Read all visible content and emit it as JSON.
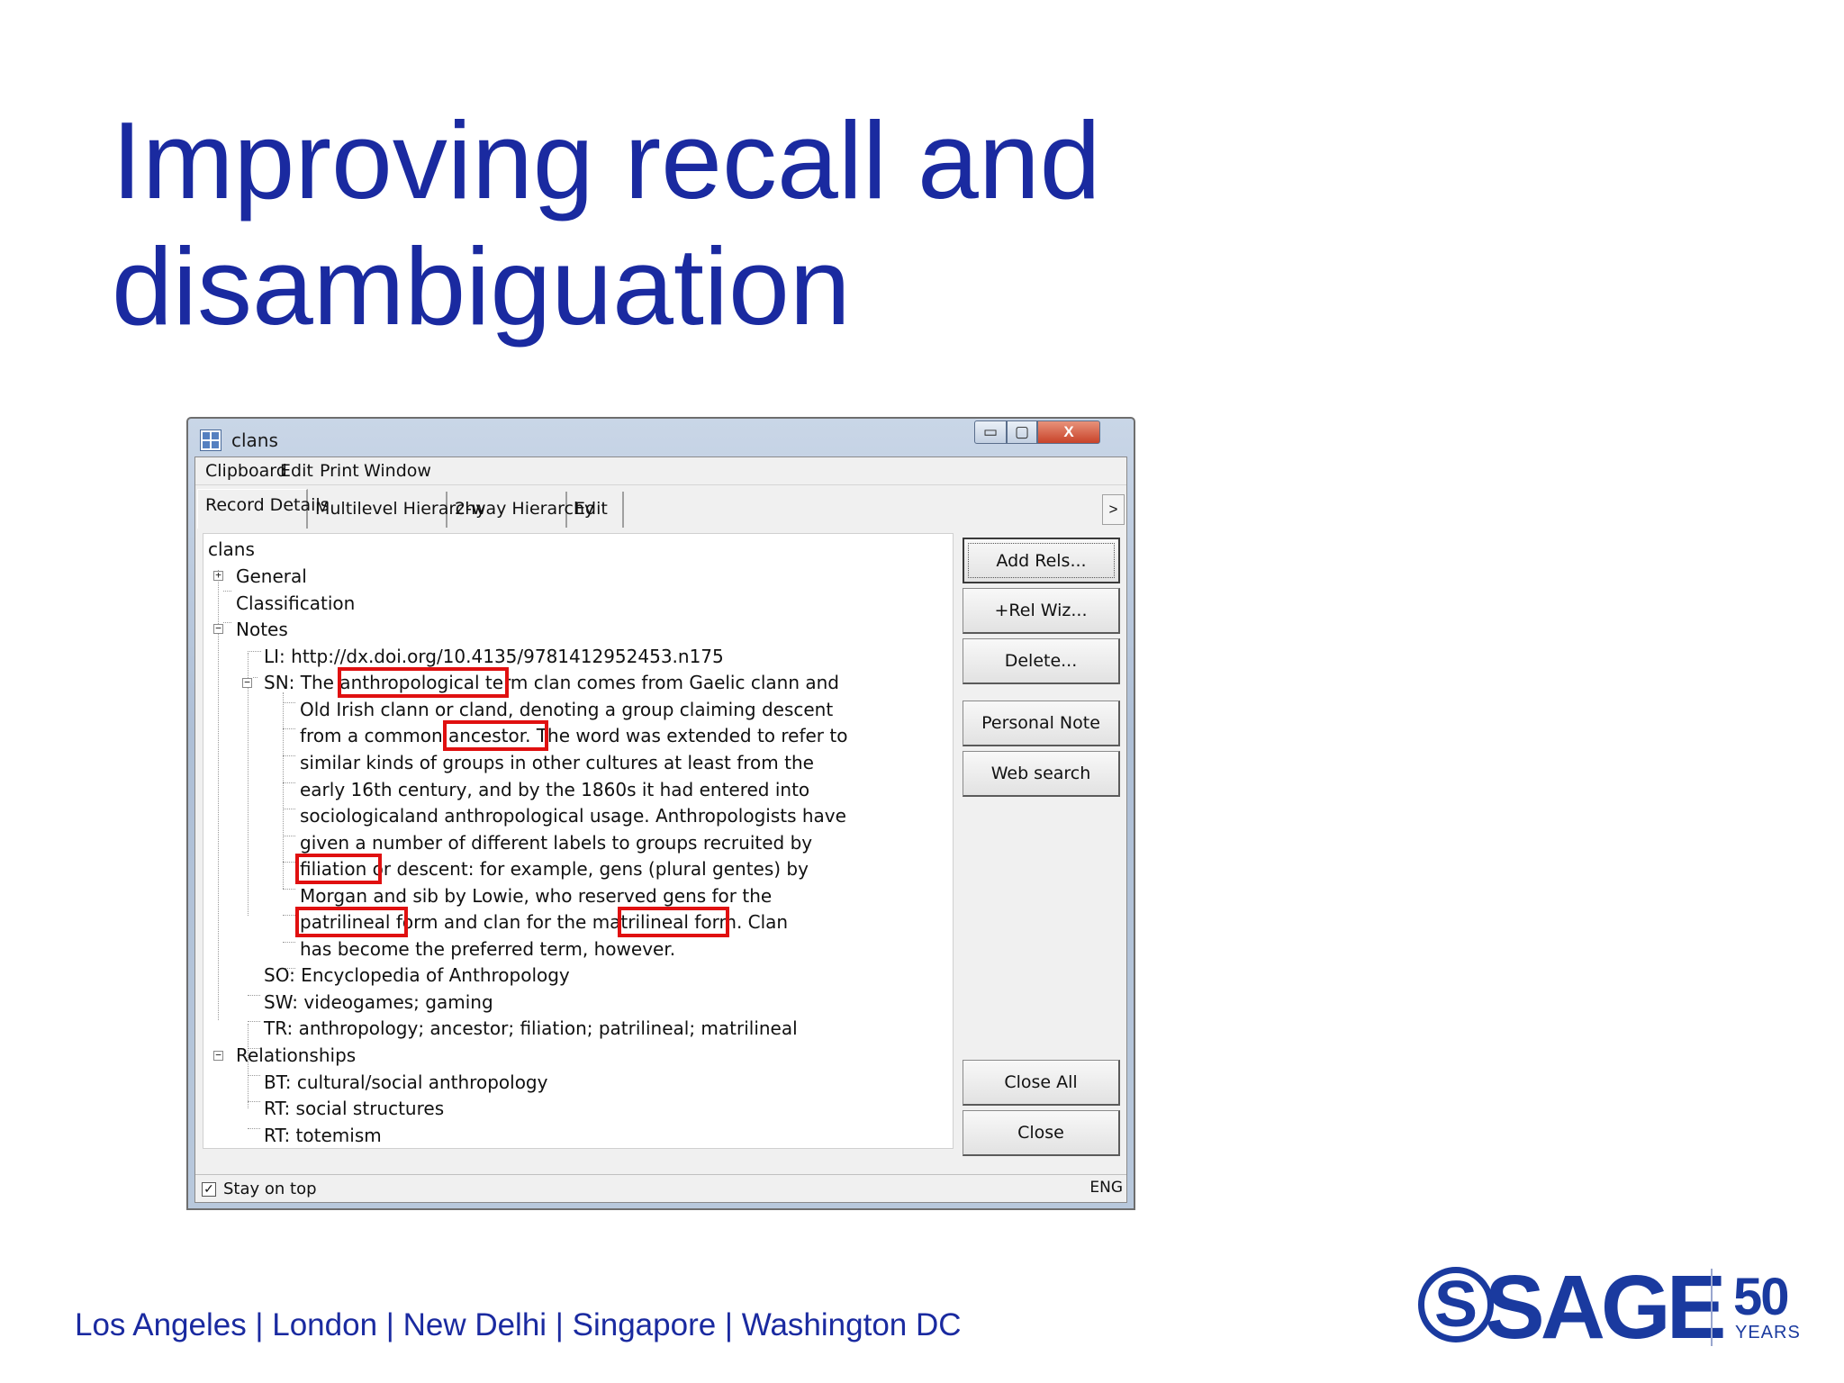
{
  "slide": {
    "title_line1": "Improving recall and",
    "title_line2": "disambiguation",
    "footer": "Los Angeles | London | New Delhi | Singapore | Washington DC",
    "logo_text": "SAGE",
    "logo_years_number": "50",
    "logo_years_label": "YEARS"
  },
  "window": {
    "title": "clans",
    "controls": {
      "minimize": "▭",
      "maximize": "▢",
      "close": "X"
    },
    "menu": [
      "Clipboard",
      "Edit",
      "Print",
      "Window"
    ],
    "tabs": [
      "Record Details",
      "Multilevel Hierarchy",
      "2-way Hierarchy",
      "Edit"
    ],
    "tab_scroll": ">",
    "tree": {
      "root": "clans",
      "general": "General",
      "classification": "Classification",
      "notes": "Notes",
      "li": "LI: http://dx.doi.org/10.4135/9781412952453.n175",
      "sn_lines": [
        "SN: The anthropological term clan comes from Gaelic clann and",
        "Old Irish clann or cland, denoting a group claiming descent",
        "from a common ancestor. The word was extended to refer to",
        "similar kinds of groups in other cultures at least from the",
        "early 16th century, and by the 1860s it had entered into",
        "sociologicaland anthropological usage. Anthropologists have",
        "given a number of different labels to groups recruited by",
        "filiation or descent: for example, gens (plural gentes) by",
        "Morgan and sib by Lowie, who reserved gens for the",
        "patrilineal form and clan for the matrilineal form. Clan",
        "has become the preferred term, however."
      ],
      "so": "SO: Encyclopedia of Anthropology",
      "sw": "SW: videogames; gaming",
      "tr": "TR: anthropology; ancestor; filiation; patrilineal; matrilineal",
      "relationships": "Relationships",
      "bt": "BT: cultural/social anthropology",
      "rt1": "RT: social structures",
      "rt2": "RT: totemism"
    },
    "buttons": {
      "add_rels": "Add Rels...",
      "rel_wiz": "+Rel Wiz...",
      "delete": "Delete...",
      "personal_note": "Personal Note",
      "web_search": "Web search",
      "close_all": "Close All",
      "close": "Close"
    },
    "status": {
      "stay_on_top": "Stay on top",
      "stay_on_top_checked": true,
      "lang": "ENG"
    }
  },
  "colors": {
    "title_blue": "#1a2aa0",
    "logo_blue": "#1a3a9f",
    "highlight_red": "#e01010"
  }
}
